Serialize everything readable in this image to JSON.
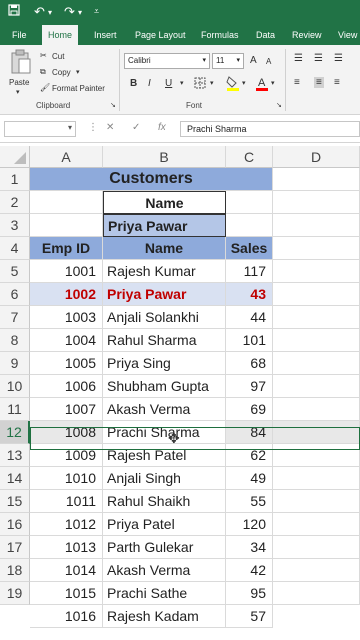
{
  "title_bar": {
    "icons": [
      "save-icon",
      "undo-icon",
      "redo-icon",
      "customize-icon"
    ]
  },
  "tabs": [
    "File",
    "Home",
    "Insert",
    "Page Layout",
    "Formulas",
    "Data",
    "Review",
    "View"
  ],
  "active_tab": "Home",
  "ribbon": {
    "clipboard": {
      "paste": "Paste",
      "cut": "Cut",
      "copy": "Copy",
      "format_painter": "Format Painter",
      "label": "Clipboard"
    },
    "font": {
      "name": "Calibri",
      "size": "11",
      "bold": "B",
      "italic": "I",
      "underline": "U",
      "grow": "A",
      "shrink": "A",
      "label": "Font"
    }
  },
  "formula_bar": {
    "cancel": "✕",
    "enter": "✓",
    "fx": "fx",
    "value": "Prachi Sharma"
  },
  "columns": [
    "A",
    "B",
    "C",
    "D"
  ],
  "rows": [
    "1",
    "2",
    "3",
    "4",
    "5",
    "6",
    "7",
    "8",
    "9",
    "10",
    "11",
    "12",
    "13",
    "14",
    "15",
    "16",
    "17",
    "18",
    "19"
  ],
  "sheet": {
    "title": "Customers",
    "lookup_label": "Name",
    "lookup_value": "Priya Pawar",
    "headers": [
      "Emp ID",
      "Name",
      "Sales"
    ],
    "records": [
      {
        "id": "1001",
        "name": "Rajesh Kumar",
        "sales": "117"
      },
      {
        "id": "1002",
        "name": "Priya Pawar",
        "sales": "43"
      },
      {
        "id": "1003",
        "name": "Anjali Solankhi",
        "sales": "44"
      },
      {
        "id": "1004",
        "name": "Rahul Sharma",
        "sales": "101"
      },
      {
        "id": "1005",
        "name": "Priya Sing",
        "sales": "68"
      },
      {
        "id": "1006",
        "name": "Shubham Gupta",
        "sales": "97"
      },
      {
        "id": "1007",
        "name": "Akash Verma",
        "sales": "69"
      },
      {
        "id": "1008",
        "name": "Prachi Sharma",
        "sales": "84"
      },
      {
        "id": "1009",
        "name": "Rajesh Patel",
        "sales": "62"
      },
      {
        "id": "1010",
        "name": "Anjali Singh",
        "sales": "49"
      },
      {
        "id": "1011",
        "name": "Rahul Shaikh",
        "sales": "55"
      },
      {
        "id": "1012",
        "name": "Priya Patel",
        "sales": "120"
      },
      {
        "id": "1013",
        "name": "Parth Gulekar",
        "sales": "34"
      },
      {
        "id": "1014",
        "name": "Akash Verma",
        "sales": "42"
      },
      {
        "id": "1015",
        "name": "Prachi Sathe",
        "sales": "95"
      },
      {
        "id": "1016",
        "name": "Rajesh Kadam",
        "sales": "57"
      }
    ]
  },
  "highlighted_record_index": 1,
  "active_record_index": 7,
  "colors": {
    "brand": "#217346",
    "header_fill": "#8eaadb",
    "lookup_fill": "#b4c6e7",
    "highlight_fill": "#d9e1f2",
    "highlight_text": "#c00000"
  }
}
